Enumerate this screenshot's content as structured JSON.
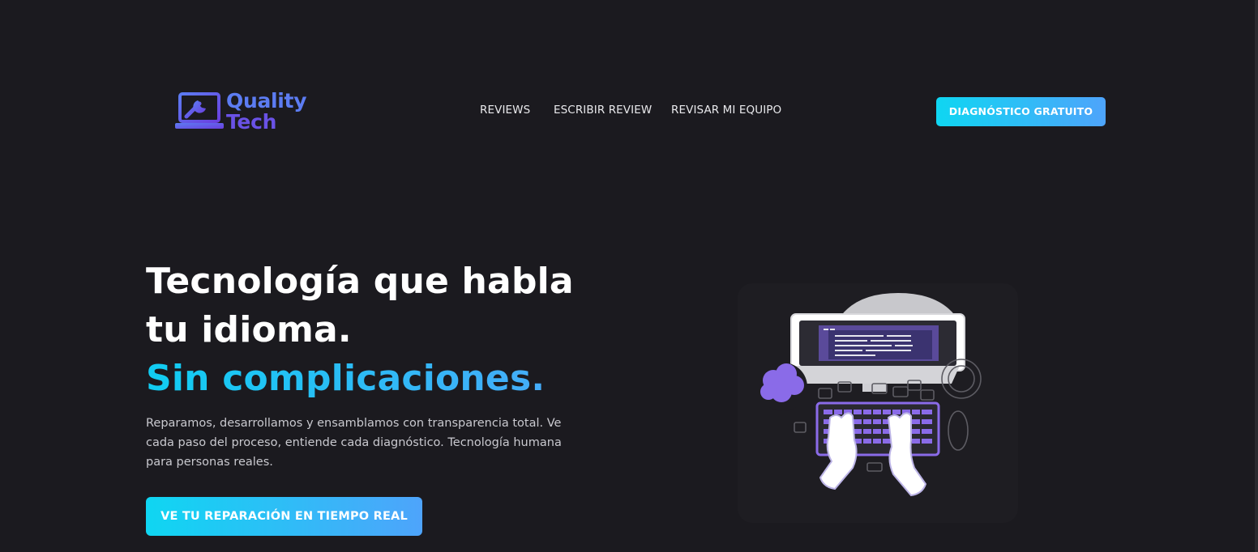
{
  "header": {
    "logo": {
      "line1": "Quality",
      "line2": "Tech"
    },
    "nav": [
      {
        "label": "REVIEWS"
      },
      {
        "label": "ESCRIBIR REVIEW"
      },
      {
        "label": "REVISAR MI EQUIPO"
      }
    ],
    "cta_label": "DIAGNÓSTICO GRATUITO"
  },
  "hero": {
    "title_line1": "Tecnología que habla",
    "title_line2": "tu idioma.",
    "title_accent": "Sin complicaciones.",
    "description": "Reparamos, desarrollamos y ensamblamos con transparencia total. Ve cada paso del proceso, entiende cada diagnóstico. Tecnología humana para personas reales.",
    "cta_label": "VE TU REPARACIÓN EN TIEMPO REAL"
  },
  "colors": {
    "background": "#1b1a1f",
    "accent_start": "#0fd6f2",
    "accent_end": "#4ea4fb",
    "brand_purple": "#6a52e6"
  },
  "icons": [
    "laptop-wrench-icon",
    "developer-illustration"
  ]
}
